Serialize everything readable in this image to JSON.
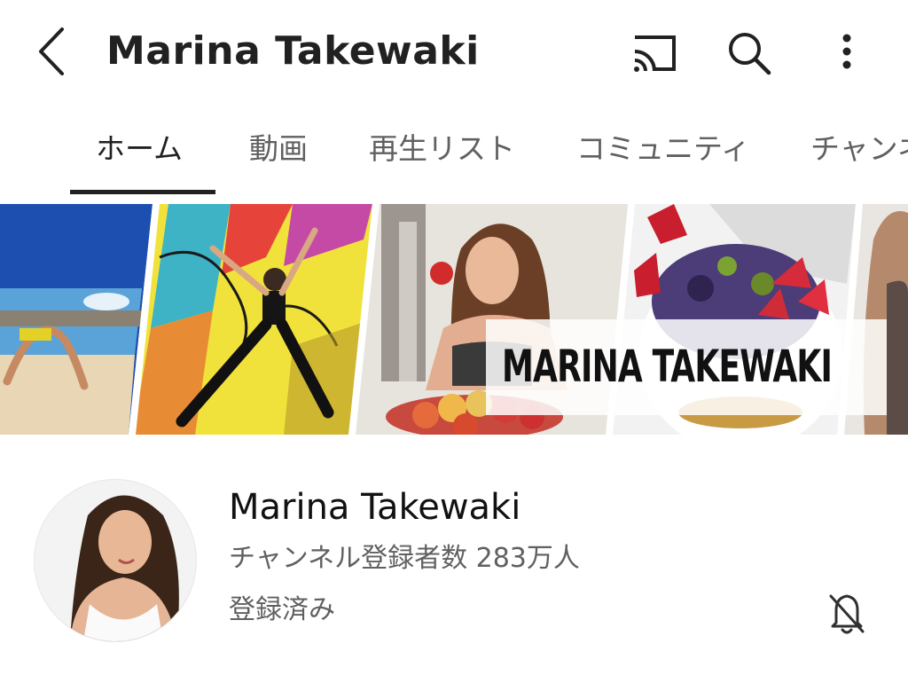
{
  "header": {
    "title": "Marina Takewaki",
    "icons": {
      "back": "back-arrow-icon",
      "cast": "cast-icon",
      "search": "search-icon",
      "more": "more-vert-icon"
    }
  },
  "tabs": [
    {
      "label": "ホーム",
      "active": true
    },
    {
      "label": "動画"
    },
    {
      "label": "再生リスト"
    },
    {
      "label": "コミュニティ"
    },
    {
      "label": "チャンネル"
    }
  ],
  "banner": {
    "title": "MARINA TAKEWAKI"
  },
  "channel": {
    "name": "Marina Takewaki",
    "subscribers": "チャンネル登録者数 283万人",
    "subscribed_label": "登録済み",
    "notification_icon": "bell-off-icon"
  },
  "colors": {
    "text_primary": "#212121",
    "text_secondary": "#606060",
    "background": "#ffffff"
  }
}
